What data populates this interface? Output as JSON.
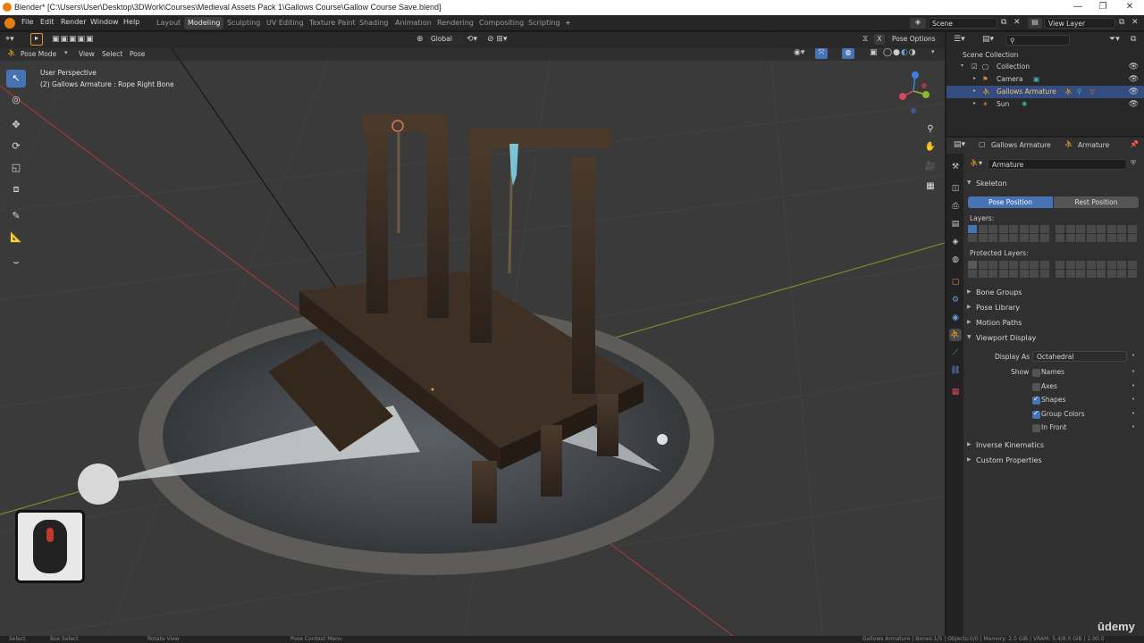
{
  "window": {
    "title": "Blender* [C:\\Users\\User\\Desktop\\3DWork\\Courses\\Medieval Assets Pack 1\\Gallows Course\\Gallow Course Save.blend]",
    "minimize": "—",
    "maximize": "❐",
    "close": "✕"
  },
  "menu": [
    "File",
    "Edit",
    "Render",
    "Window",
    "Help"
  ],
  "workspaces": [
    "Layout",
    "Modeling",
    "Sculpting",
    "UV Editing",
    "Texture Paint",
    "Shading",
    "Animation",
    "Rendering",
    "Compositing",
    "Scripting"
  ],
  "active_workspace": "Modeling",
  "scene": {
    "label": "Scene",
    "view_layer": "View Layer"
  },
  "viewport": {
    "transform_orientation": "Global",
    "pose_options": "Pose Options",
    "mode": "Pose Mode",
    "menus": [
      "View",
      "Select",
      "Pose"
    ],
    "overlay_title": "User Perspective",
    "overlay_subtitle": "(2) Gallows Armature : Rope Right Bone",
    "x_toggle": "X",
    "gizmo": {
      "x": "X",
      "y": "Y",
      "z": "Z"
    }
  },
  "outliner": {
    "search_placeholder": "",
    "root": "Scene Collection",
    "items": [
      {
        "label": "Collection",
        "icon": "collection-icon"
      },
      {
        "label": "Camera",
        "icon": "camera-icon"
      },
      {
        "label": "Gallows Armature",
        "icon": "armature-icon",
        "selected": true
      },
      {
        "label": "Sun",
        "icon": "light-icon"
      }
    ]
  },
  "properties": {
    "breadcrumb_object": "Gallows Armature",
    "breadcrumb_data": "Armature",
    "data_name": "Armature",
    "panels": {
      "skeleton": "Skeleton",
      "pose_position": "Pose Position",
      "rest_position": "Rest Position",
      "layers": "Layers:",
      "protected_layers": "Protected Layers:",
      "bone_groups": "Bone Groups",
      "pose_library": "Pose Library",
      "motion_paths": "Motion Paths",
      "viewport_display": "Viewport Display",
      "display_as_label": "Display As",
      "display_as_value": "Octahedral",
      "show_label": "Show",
      "inverse_kinematics": "Inverse Kinematics",
      "custom_properties": "Custom Properties"
    },
    "show_options": [
      {
        "label": "Names",
        "checked": false
      },
      {
        "label": "Axes",
        "checked": false
      },
      {
        "label": "Shapes",
        "checked": true
      },
      {
        "label": "Group Colors",
        "checked": true
      },
      {
        "label": "In Front",
        "checked": false
      }
    ]
  },
  "watermark": "ūdemy",
  "status": {
    "select": "Select",
    "box_select": "Box Select",
    "rotate_view": "Rotate View",
    "context_menu": "Pose Context Menu",
    "right": "Gallows Armature | Bones:1/5 | Objects:0/0 | Memory: 2.0 GiB | VRAM: 5.4/8.0 GiB | 2.90.0"
  },
  "colors": {
    "accent": "#4772b3",
    "selected_row": "#334d80",
    "blender_orange": "#e87d0d",
    "viewport_bg": "#3a3a3a"
  }
}
